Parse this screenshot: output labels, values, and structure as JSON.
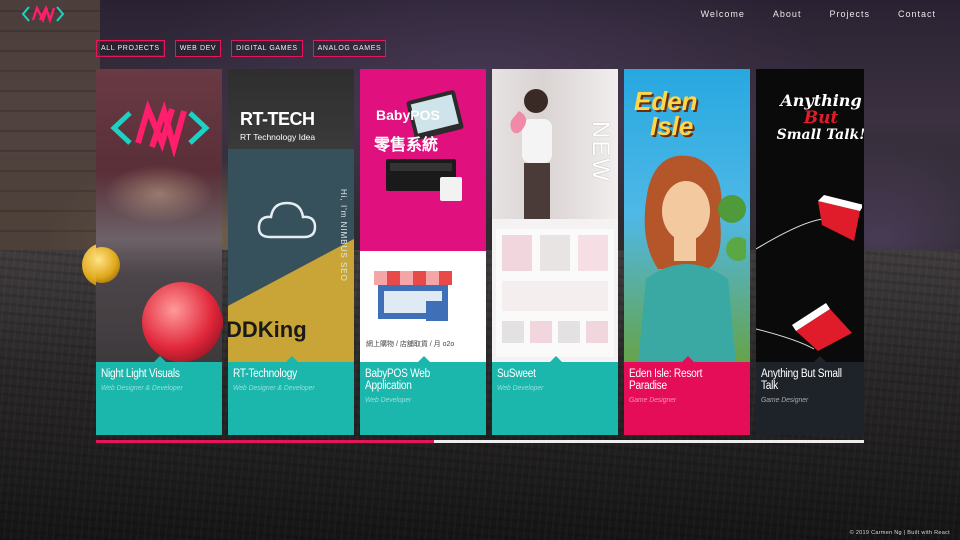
{
  "header": {
    "nav": [
      "Welcome",
      "About",
      "Projects",
      "Contact"
    ]
  },
  "filters": [
    "ALL PROJECTS",
    "WEB DEV",
    "DIGITAL GAMES",
    "ANALOG GAMES"
  ],
  "projects": [
    {
      "title": "Night Light Visuals",
      "role": "Web Designer & Developer",
      "color": "#1bb7ad"
    },
    {
      "title": "RT-Technology",
      "role": "Web Designer & Developer",
      "color": "#1bb7ad",
      "thumb_text": {
        "brand": "RT-TECH",
        "tagline": "RT Technology Idea",
        "side": "Hi, I'm NIMBUS SEO",
        "yellow": "DDKing"
      }
    },
    {
      "title": "BabyPOS Web Application",
      "role": "Web Developer",
      "color": "#1bb7ad",
      "thumb_text": {
        "brand": "BabyPOS",
        "brand_cn": "零售系統",
        "sub": "網上購物 / 店舖取貨 / 月 o2o"
      }
    },
    {
      "title": "SuSweet",
      "role": "Web Developer",
      "color": "#1bb7ad",
      "thumb_text": {
        "side": "NEW"
      }
    },
    {
      "title": "Eden Isle: Resort Paradise",
      "role": "Game Designer",
      "color": "#e50d57",
      "thumb_text": {
        "logo_line1": "Eden",
        "logo_line2": "Isle"
      }
    },
    {
      "title": "Anything But Small Talk",
      "role": "Game Designer",
      "color": "#1e2329",
      "thumb_text": {
        "line1": "Anything",
        "line2": "But",
        "line3": "Small Talk!"
      }
    }
  ],
  "progress": {
    "percent": 44
  },
  "footer": "© 2019 Carmen Ng | Built with React"
}
